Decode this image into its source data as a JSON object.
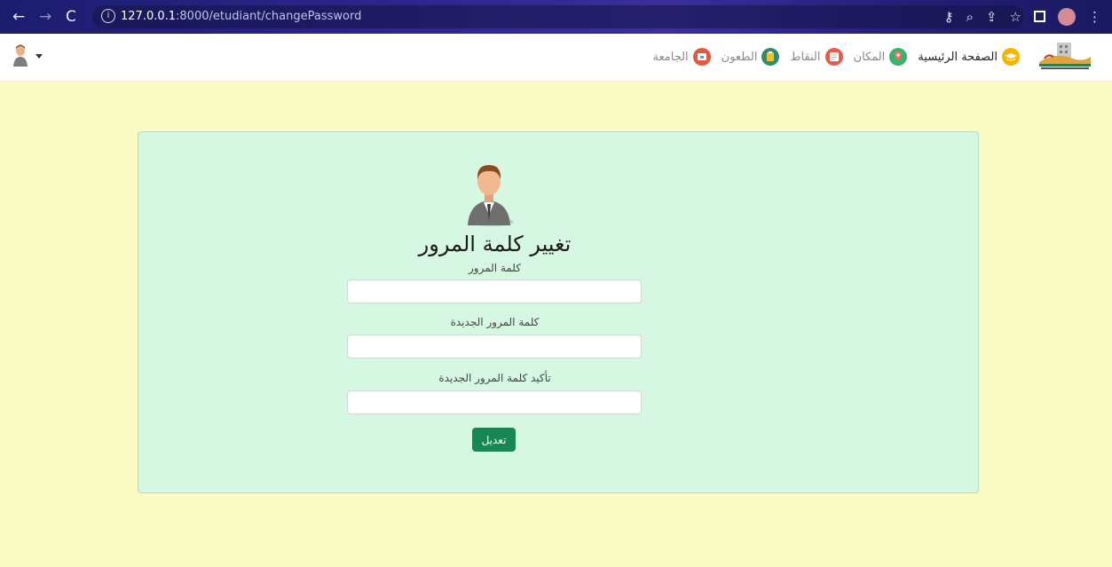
{
  "browser": {
    "url_host": "127.0.0.1",
    "url_rest": ":8000/etudiant/changePassword"
  },
  "navbar": {
    "items": [
      {
        "label": "الصفحة الرئيسية",
        "icon": "graduation-cap-icon",
        "color": "#f5b400"
      },
      {
        "label": "المكان",
        "icon": "map-pin-icon",
        "color": "#3ab36a"
      },
      {
        "label": "النقاط",
        "icon": "notes-icon",
        "color": "#e85a4a"
      },
      {
        "label": "الطعون",
        "icon": "clipboard-icon",
        "color": "#2f8f6c"
      },
      {
        "label": "الجامعة",
        "icon": "university-icon",
        "color": "#e8563f"
      }
    ]
  },
  "form": {
    "title": "تغيير كلمة المرور",
    "current_password_label": "كلمة المرور",
    "new_password_label": "كلمة المرور الجديدة",
    "confirm_password_label": "تأكيد كلمة المرور الجديدة",
    "submit_label": "تعديل"
  },
  "colors": {
    "page_bg": "#fbfcc4",
    "card_bg": "#d6f7e1",
    "button": "#198754"
  }
}
